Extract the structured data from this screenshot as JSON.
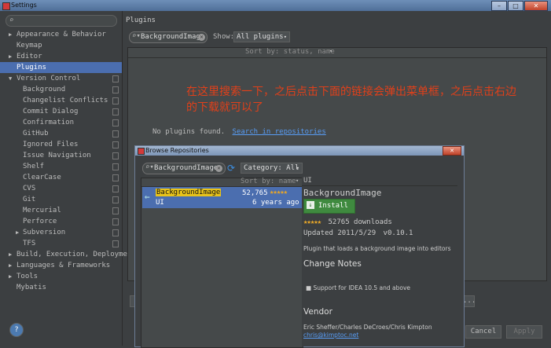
{
  "window": {
    "title": "Settings",
    "buttons": [
      "–",
      "□",
      "✕"
    ]
  },
  "sidebar": {
    "items": [
      {
        "label": "Appearance & Behavior",
        "arrow": "right",
        "indent": 0
      },
      {
        "label": "Keymap",
        "arrow": "none",
        "indent": 0
      },
      {
        "label": "Editor",
        "arrow": "right",
        "indent": 0
      },
      {
        "label": "Plugins",
        "arrow": "none",
        "indent": 0,
        "selected": true
      },
      {
        "label": "Version Control",
        "arrow": "down",
        "indent": 0,
        "copy": true
      },
      {
        "label": "Background",
        "indent": 1,
        "copy": true
      },
      {
        "label": "Changelist Conflicts",
        "indent": 1,
        "copy": true
      },
      {
        "label": "Commit Dialog",
        "indent": 1,
        "copy": true
      },
      {
        "label": "Confirmation",
        "indent": 1,
        "copy": true
      },
      {
        "label": "GitHub",
        "indent": 1,
        "copy": true
      },
      {
        "label": "Ignored Files",
        "indent": 1,
        "copy": true
      },
      {
        "label": "Issue Navigation",
        "indent": 1,
        "copy": true
      },
      {
        "label": "Shelf",
        "indent": 1,
        "copy": true
      },
      {
        "label": "ClearCase",
        "indent": 1,
        "copy": true
      },
      {
        "label": "CVS",
        "indent": 1,
        "copy": true
      },
      {
        "label": "Git",
        "indent": 1,
        "copy": true
      },
      {
        "label": "Mercurial",
        "indent": 1,
        "copy": true
      },
      {
        "label": "Perforce",
        "indent": 1,
        "copy": true
      },
      {
        "label": "Subversion",
        "arrow": "right",
        "indent": 1,
        "copy": true
      },
      {
        "label": "TFS",
        "indent": 1,
        "copy": true
      },
      {
        "label": "Build, Execution, Deployme",
        "arrow": "right",
        "indent": 0
      },
      {
        "label": "Languages & Frameworks",
        "arrow": "right",
        "indent": 0
      },
      {
        "label": "Tools",
        "arrow": "right",
        "indent": 0
      },
      {
        "label": "Mybatis",
        "arrow": "none",
        "indent": 0
      }
    ]
  },
  "main": {
    "title": "Plugins",
    "search_value": "BackgroundImage",
    "show_label": "Show:",
    "show_value": "All plugins",
    "sort_label": "Sort by: status, name",
    "annotation_line1": "在这里搜索一下，之后点击下面的链接会弹出菜单框，之后点击右边",
    "annotation_line2": "的下载就可以了",
    "no_plugins_text": "No plugins found.",
    "search_repos_link": "Search in repositories"
  },
  "footer": {
    "help": "?",
    "cancel": "Cancel",
    "apply": "Apply",
    "more": "..."
  },
  "dialog": {
    "title": "Browse Repositories",
    "close": "✕",
    "search_value": "BackgroundImage",
    "category_label": "Category: All",
    "sort_label": "Sort by: name",
    "results": [
      {
        "name": "BackgroundImage",
        "downloads": "52,765",
        "category": "UI",
        "age": "6 years ago",
        "stars": "★★★★★"
      }
    ],
    "detail": {
      "category": "UI",
      "name": "BackgroundImage",
      "install_label": "Install",
      "stars": "★★★★★",
      "downloads_text": "52765 downloads",
      "updated_text": "Updated 2011/5/29",
      "version": "v0.10.1",
      "description": "Plugin that loads a background image into editors",
      "change_notes_heading": "Change Notes",
      "change_notes_item": "Support for IDEA 10.5 and above",
      "vendor_heading": "Vendor",
      "vendor_names": "Eric Sheffer/Charles DeCroes/Chris Kimpton",
      "vendor_email": "chris@kimptoc.net"
    }
  },
  "colors": {
    "accent": "#4b6eaf",
    "annotation": "#e0401a",
    "link": "#589df6",
    "install": "#499c54"
  }
}
